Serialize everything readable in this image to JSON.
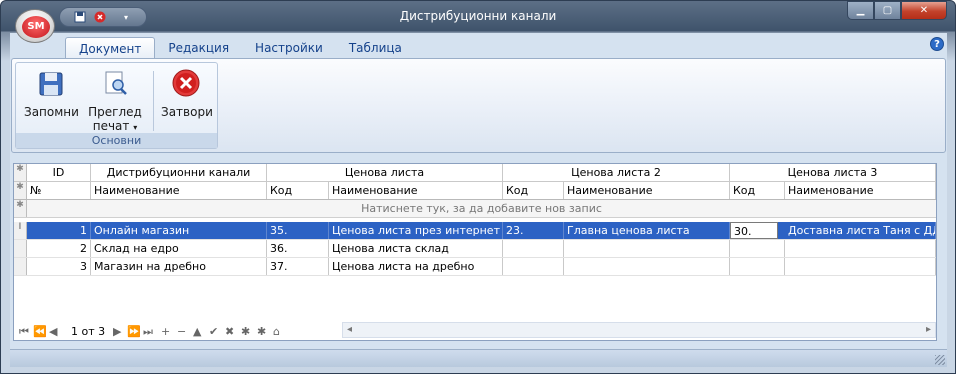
{
  "window": {
    "title": "Дистрибуционни канали",
    "app_badge": "SM"
  },
  "quick_access": {
    "save_icon": "save-icon",
    "close_icon": "close-icon",
    "dropdown_icon": "chevron-down-icon"
  },
  "window_controls": {
    "minimize": "▁",
    "maximize": "▢",
    "close": "✕"
  },
  "ribbon": {
    "tabs": [
      "Документ",
      "Редакция",
      "Настройки",
      "Таблица"
    ],
    "active_tab": "Документ",
    "help": "?",
    "group_label": "Основни",
    "buttons": {
      "save": "Запомни",
      "preview_line1": "Преглед",
      "preview_line2": "печат",
      "close": "Затвори"
    }
  },
  "grid": {
    "header_top": {
      "id": "ID",
      "channels": "Дистрибуционни канали",
      "pricelist": "Ценова листа",
      "pricelist2": "Ценова листа 2",
      "pricelist3": "Ценова листа 3"
    },
    "header_sub": {
      "num": "№",
      "name": "Наименование",
      "code": "Код",
      "pl_name": "Наименование",
      "code2": "Код",
      "pl2_name": "Наименование",
      "code3": "Код",
      "pl3_name": "Наименование"
    },
    "new_row_hint": "Натиснете тук, за да добавите нов запис",
    "rows": [
      {
        "num": "1",
        "name": "Онлайн магазин",
        "code": "35.",
        "pl_name": "Ценова листа през интернет",
        "code2": "23.",
        "pl2_name": "Главна ценова листа",
        "code3": "30.",
        "pl3_name": "Доставна листа Таня с ДДС"
      },
      {
        "num": "2",
        "name": "Склад на едро",
        "code": "36.",
        "pl_name": "Ценова листа склад",
        "code2": "",
        "pl2_name": "",
        "code3": "",
        "pl3_name": ""
      },
      {
        "num": "3",
        "name": "Магазин на дребно",
        "code": "37.",
        "pl_name": "Ценова листа на дребно",
        "code2": "",
        "pl2_name": "",
        "code3": "",
        "pl3_name": ""
      }
    ],
    "navigator": {
      "page_info": "1 от 3",
      "buttons": [
        "⏮",
        "⏪",
        "◀",
        "▶",
        "⏩",
        "⏭",
        "+",
        "−",
        "▲",
        "✔",
        "✖",
        "✱",
        "✱",
        "⌂"
      ]
    }
  },
  "colors": {
    "accent": "#2c62c4",
    "ribbon_text": "#15428b"
  }
}
